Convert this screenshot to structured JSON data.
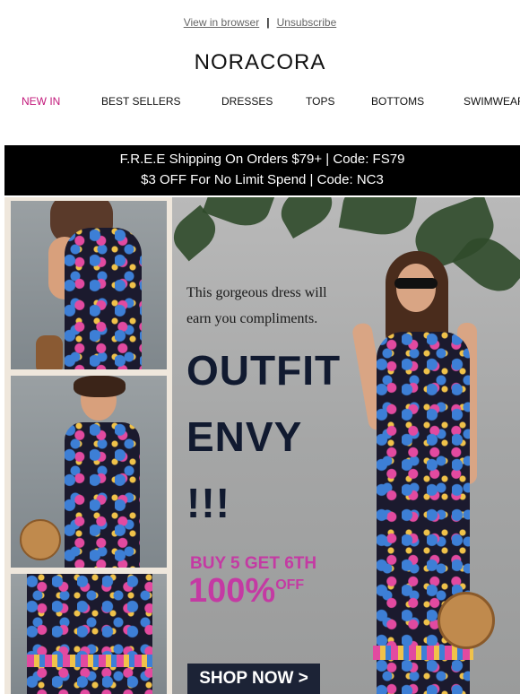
{
  "header": {
    "view_in_browser": "View in browser",
    "separator": "|",
    "unsubscribe": "Unsubscribe",
    "brand": "NORACORA"
  },
  "nav": {
    "items": [
      "NEW IN",
      "BEST SELLERS",
      "DRESSES",
      "TOPS",
      "BOTTOMS",
      "SWIMWEAR"
    ]
  },
  "banner": {
    "line1": "F.R.E.E Shipping On Orders $79+ | Code: FS79",
    "line2": "$3 OFF For No Limit Spend | Code: NC3"
  },
  "hero": {
    "tagline_1": "This gorgeous dress will",
    "tagline_2": "earn you compliments.",
    "headline_1": "OUTFIT",
    "headline_2": "ENVY",
    "headline_3": "!!!",
    "promo_1": "BUY 5 GET 6TH",
    "promo_2": "100%",
    "promo_2_suffix": "OFF",
    "cta": "SHOP NOW >"
  },
  "colors": {
    "accent": "#c2187a",
    "promo": "#c43aa3",
    "banner_bg": "#000000",
    "cta_bg": "#1c2336"
  }
}
